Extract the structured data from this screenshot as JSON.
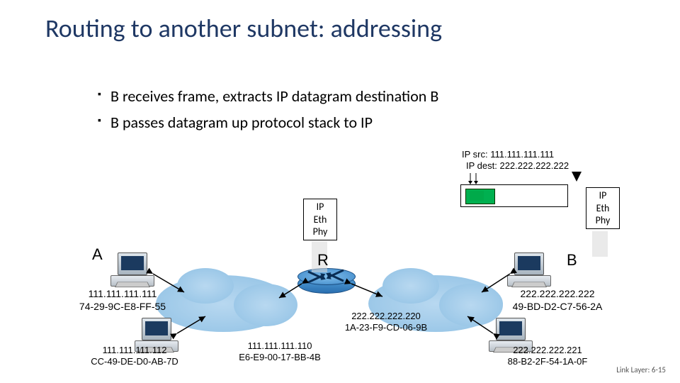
{
  "title": "Routing to another subnet: addressing",
  "bullets": [
    "B receives frame, extracts IP datagram destination B",
    "B passes datagram up protocol stack to IP"
  ],
  "packet": {
    "ip_src_label": "IP src:",
    "ip_src": "111.111.111.111",
    "ip_dest_label": "IP dest:",
    "ip_dest": "222.222.222.222"
  },
  "stack_layers": [
    "IP",
    "Eth",
    "Phy"
  ],
  "nodes": {
    "A": {
      "label": "A",
      "ip": "111.111.111.111",
      "mac": "74-29-9C-E8-FF-55"
    },
    "A2": {
      "ip": "111.111.111.112",
      "mac": "CC-49-DE-D0-AB-7D"
    },
    "R_left": {
      "ip": "111.111.111.110",
      "mac": "E6-E9-00-17-BB-4B"
    },
    "R_right": {
      "ip": "222.222.222.220",
      "mac": "1A-23-F9-CD-06-9B"
    },
    "R": {
      "label": "R"
    },
    "B": {
      "label": "B",
      "ip": "222.222.222.222",
      "mac": "49-BD-D2-C7-56-2A"
    },
    "B2": {
      "ip": "222.222.222.221",
      "mac": "88-B2-2F-54-1A-0F"
    }
  },
  "footer": "Link Layer: 6-15"
}
